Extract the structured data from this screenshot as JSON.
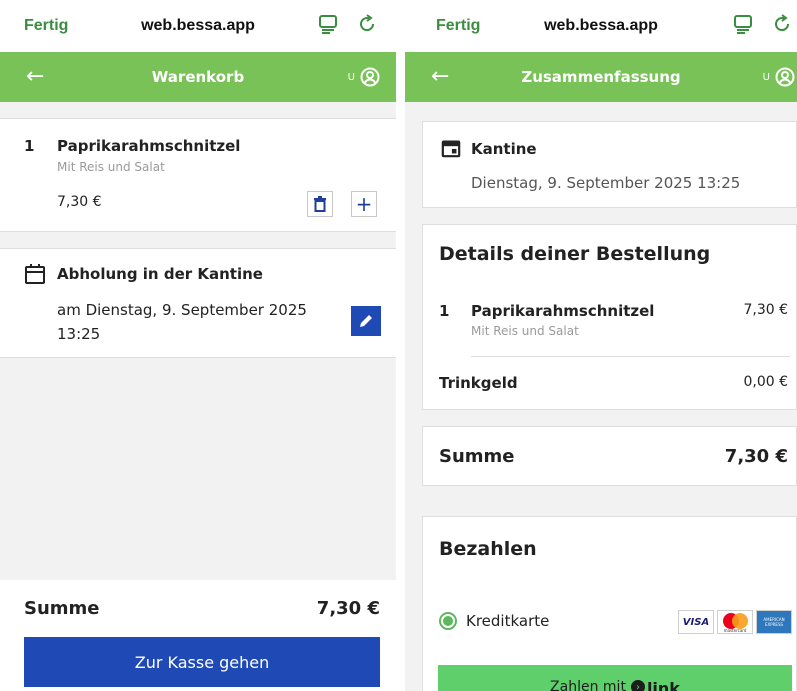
{
  "browser": {
    "done": "Fertig",
    "url": "web.bessa.app"
  },
  "cart": {
    "title": "Warenkorb",
    "user_initial": "U",
    "item": {
      "qty": "1",
      "name": "Paprikarahmschnitzel",
      "desc": "Mit Reis und Salat",
      "price": "7,30 €"
    },
    "pickup": {
      "title": "Abholung in der Kantine",
      "date": "am Dienstag, 9. September 2025 13:25"
    },
    "sum_label": "Summe",
    "sum_value": "7,30 €",
    "checkout_label": "Zur Kasse gehen"
  },
  "summary": {
    "title": "Zusammenfassung",
    "user_initial": "U",
    "location": {
      "name": "Kantine",
      "date": "Dienstag, 9. September 2025 13:25"
    },
    "details_title": "Details deiner Bestellung",
    "item": {
      "qty": "1",
      "name": "Paprikarahmschnitzel",
      "desc": "Mit Reis und Salat",
      "price": "7,30 €"
    },
    "tip": {
      "label": "Trinkgeld",
      "value": "0,00 €"
    },
    "sum_label": "Summe",
    "sum_value": "7,30 €",
    "pay_title": "Bezahlen",
    "method_label": "Kreditkarte",
    "card_logos": [
      "VISA",
      "mastercard",
      "AMERICAN EXPRESS"
    ],
    "pay_button_prefix": "Zahlen mit",
    "pay_button_brand": "link"
  },
  "colors": {
    "green_bar": "#78c257",
    "blue": "#1f49b5",
    "safari_green": "#3b8e3f",
    "pay_green": "#5ecf6b"
  }
}
